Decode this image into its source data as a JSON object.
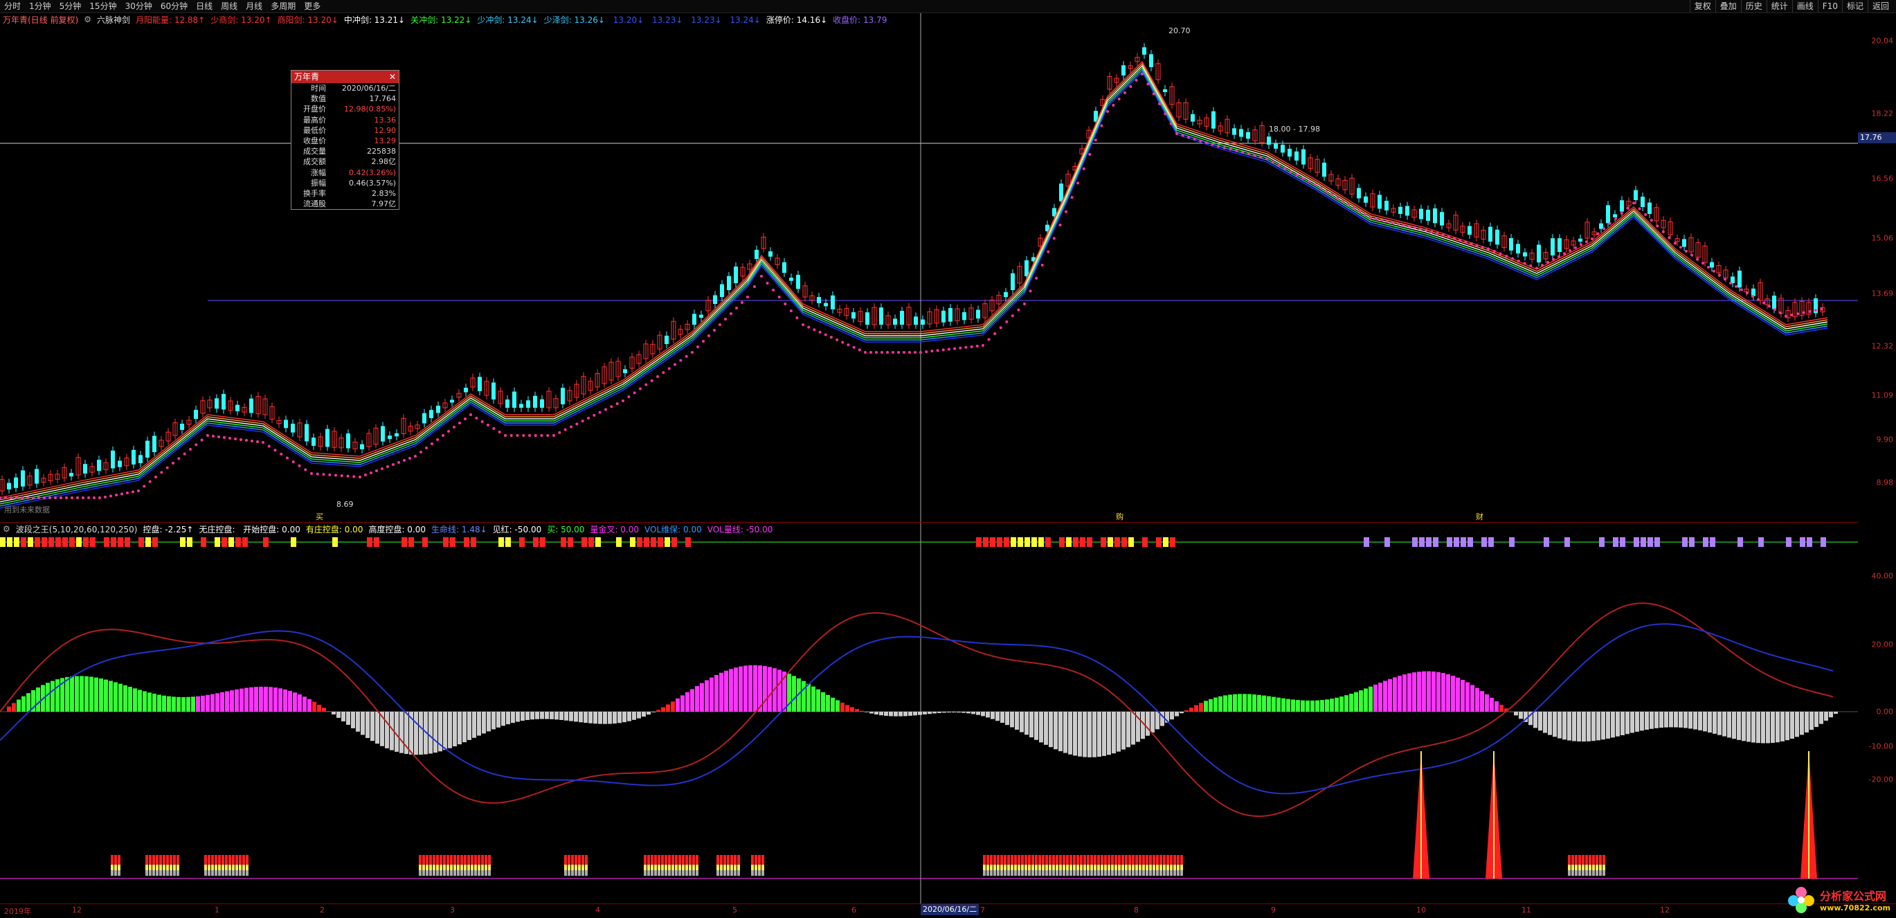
{
  "toolbar": {
    "periods": [
      "分时",
      "1分钟",
      "5分钟",
      "15分钟",
      "30分钟",
      "60分钟",
      "日线",
      "周线",
      "月线",
      "多周期",
      "更多"
    ],
    "right": [
      "复权",
      "叠加",
      "历史",
      "统计",
      "画线",
      "F10",
      "标记",
      "返回"
    ]
  },
  "main_legend": {
    "title": "万年青(日线 前复权)",
    "indicator": "六脉神剑",
    "items": [
      {
        "label": "月阳能量:",
        "value": "12.88",
        "arrow": "↑",
        "color": "#ff3333"
      },
      {
        "label": "少商剑:",
        "value": "13.20",
        "arrow": "↑",
        "color": "#ff3333"
      },
      {
        "label": "商阳剑:",
        "value": "13.20",
        "arrow": "↓",
        "color": "#ff3333"
      },
      {
        "label": "中冲剑:",
        "value": "13.21",
        "arrow": "↓",
        "color": "#ffffff"
      },
      {
        "label": "关冲剑:",
        "value": "13.22",
        "arrow": "↓",
        "color": "#33ff33"
      },
      {
        "label": "少冲剑:",
        "value": "13.24",
        "arrow": "↓",
        "color": "#33ccff"
      },
      {
        "label": "少泽剑:",
        "value": "13.26",
        "arrow": "↓",
        "color": "#33ccff"
      },
      {
        "label": "",
        "value": "13.20",
        "arrow": "↓",
        "color": "#3355ff"
      },
      {
        "label": "",
        "value": "13.23",
        "arrow": "↓",
        "color": "#3355ff"
      },
      {
        "label": "",
        "value": "13.23",
        "arrow": "↓",
        "color": "#3355ff"
      },
      {
        "label": "",
        "value": "13.24",
        "arrow": "↓",
        "color": "#3355ff"
      },
      {
        "label": "涨停价:",
        "value": "14.16",
        "arrow": "↓",
        "color": "#ffffff"
      },
      {
        "label": "收盘价:",
        "value": "13.79",
        "arrow": "",
        "color": "#9966ff"
      }
    ]
  },
  "sub_legend": {
    "title": "波段之王(5,10,20,60,120,250)",
    "items": [
      {
        "label": "控盘:",
        "value": "-2.25",
        "arrow": "↑",
        "color": "#ffffff"
      },
      {
        "label": "无庄控盘:",
        "value": "",
        "arrow": "",
        "color": "#ffffff"
      },
      {
        "label": "开始控盘:",
        "value": "0.00",
        "arrow": "",
        "color": "#ffffff"
      },
      {
        "label": "有庄控盘:",
        "value": "0.00",
        "arrow": "",
        "color": "#ffff33"
      },
      {
        "label": "高度控盘:",
        "value": "0.00",
        "arrow": "",
        "color": "#ffffff"
      },
      {
        "label": "生命线:",
        "value": "1.48",
        "arrow": "↓",
        "color": "#6688ff"
      },
      {
        "label": "见红:",
        "value": "-50.00",
        "arrow": "",
        "color": "#ffffff"
      },
      {
        "label": "买:",
        "value": "50.00",
        "arrow": "",
        "color": "#33ff33"
      },
      {
        "label": "量金叉:",
        "value": "0.00",
        "arrow": "",
        "color": "#ff33ff"
      },
      {
        "label": "VOL维保:",
        "value": "0.00",
        "arrow": "",
        "color": "#3399ff"
      },
      {
        "label": "VOL量线:",
        "value": "-50.00",
        "arrow": "",
        "color": "#ff33ff"
      }
    ]
  },
  "price_axis": [
    "20.04",
    "18.22",
    "16.56",
    "15.06",
    "13.69",
    "12.32",
    "11.09",
    "9.90",
    "8.98"
  ],
  "price_tag": "17.76",
  "sub_axis": [
    "40.00",
    "20.00",
    "0.00",
    "-10.00",
    "-20.00"
  ],
  "date_axis": [
    "2019年",
    "12",
    "1",
    "2",
    "3",
    "4",
    "5",
    "6",
    "7",
    "8",
    "9",
    "10",
    "11",
    "12"
  ],
  "cursor_date": "2020/06/16/二",
  "popup": {
    "title": "万年青",
    "rows": [
      {
        "k": "时间",
        "v": "2020/06/16/二",
        "c": "#dddddd"
      },
      {
        "k": "数值",
        "v": "17.764",
        "c": "#dddddd"
      },
      {
        "k": "开盘价",
        "v": "12.98(0.85%)",
        "c": "#ff4444"
      },
      {
        "k": "最高价",
        "v": "13.36",
        "c": "#ff4444"
      },
      {
        "k": "最低价",
        "v": "12.90",
        "c": "#ff4444"
      },
      {
        "k": "收盘价",
        "v": "13.29",
        "c": "#ff4444"
      },
      {
        "k": "成交量",
        "v": "225838",
        "c": "#dddddd"
      },
      {
        "k": "成交额",
        "v": "2.98亿",
        "c": "#dddddd"
      },
      {
        "k": "涨幅",
        "v": "0.42(3.26%)",
        "c": "#ff4444"
      },
      {
        "k": "振幅",
        "v": "0.46(3.57%)",
        "c": "#dddddd"
      },
      {
        "k": "换手率",
        "v": "2.83%",
        "c": "#dddddd"
      },
      {
        "k": "流通股",
        "v": "7.97亿",
        "c": "#dddddd"
      }
    ]
  },
  "annotations": {
    "peak_high": "20.70",
    "low": "8.69",
    "range": "18.00 - 17.98",
    "note": "用到未来数据",
    "buy1": "买",
    "buy2": "购",
    "buy3": "财"
  },
  "colors": {
    "up": "#ff3333",
    "down": "#33ffff",
    "ma": "#ff3399",
    "grid": "#8b0000"
  },
  "watermark": {
    "line1": "分析家公式网",
    "line2": "www.70822.com"
  }
}
